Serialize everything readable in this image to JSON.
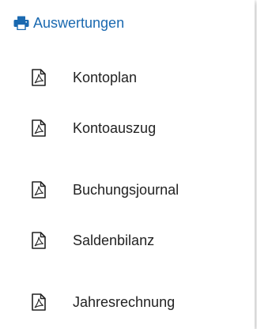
{
  "colors": {
    "accent": "#1a69b0",
    "text": "#222222",
    "icon": "#222222"
  },
  "menu": {
    "header": {
      "icon": "print-icon",
      "label": "Auswertungen"
    },
    "items": [
      {
        "icon": "pdf-icon",
        "label": "Kontoplan"
      },
      {
        "icon": "pdf-icon",
        "label": "Kontoauszug"
      },
      {
        "icon": "pdf-icon",
        "label": "Buchungsjournal"
      },
      {
        "icon": "pdf-icon",
        "label": "Saldenbilanz"
      },
      {
        "icon": "pdf-icon",
        "label": "Jahresrechnung"
      }
    ]
  }
}
